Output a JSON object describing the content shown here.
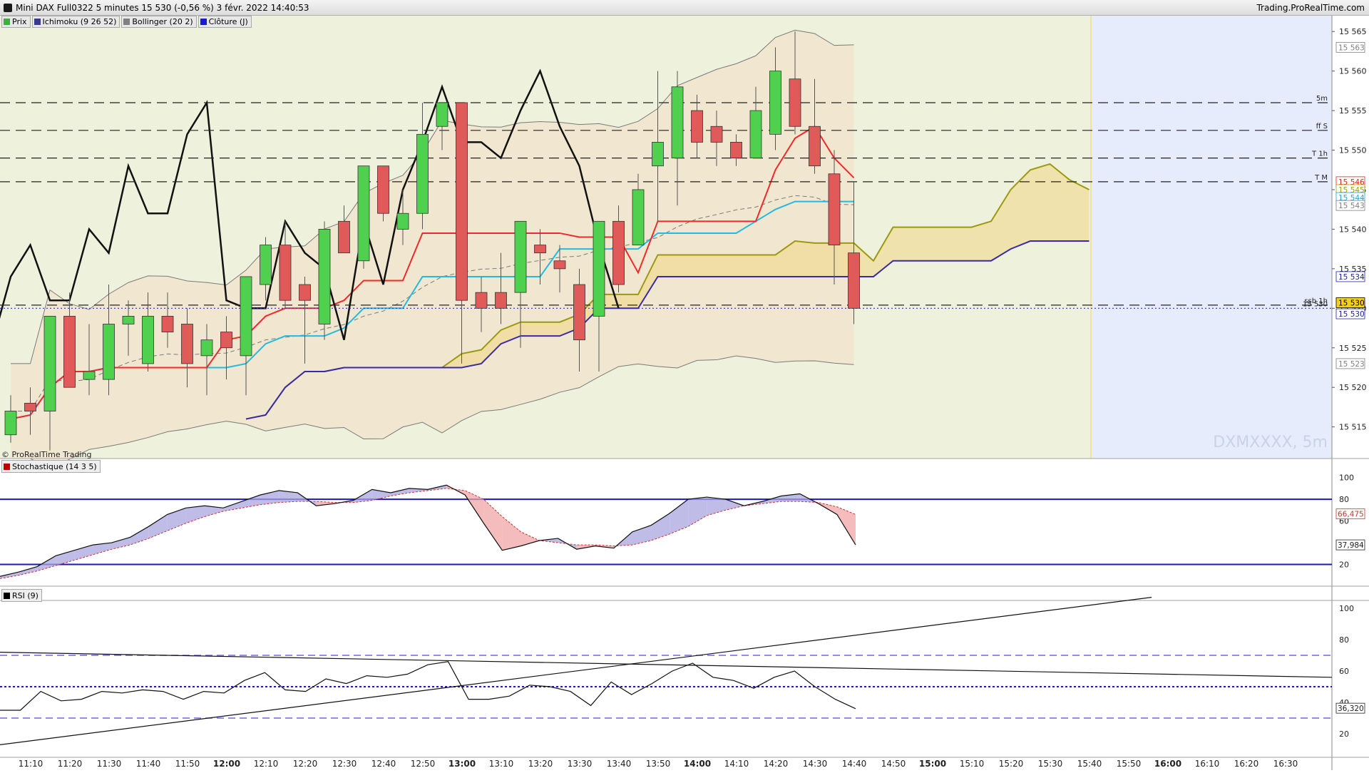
{
  "title": "Mini DAX Full0322 5 minutes 15 530 (-0,56 %) 3 févr. 2022 14:40:53",
  "site": "Trading.ProRealTime.com",
  "legend": [
    {
      "label": "Prix",
      "color": "#3fae3f"
    },
    {
      "label": "Ichimoku (9 26 52)",
      "color": "#3a3a8a"
    },
    {
      "label": "Bollinger (20 2)",
      "color": "#808080"
    },
    {
      "label": "Clôture (J)",
      "color": "#1a1ad0"
    }
  ],
  "copyright": "© ProRealTime Trading",
  "watermark": "DXMXXXX, 5m",
  "stoch_label": "Stochastique (14 3 5)",
  "rsi_label": "RSI (9)",
  "colors": {
    "up": "#4fd14f",
    "down": "#e05a5a",
    "cloud_bull": "#a8e3dc",
    "cloud_bear": "#f2d98c",
    "bg_session": "#eef1dc",
    "bg_future": "#e6ecfb"
  },
  "chart_data": [
    {
      "type": "candlestick",
      "name": "price",
      "ylim": [
        15511,
        15567
      ],
      "y_ticks": [
        15515,
        15520,
        15525,
        15530,
        15535,
        15540,
        15545,
        15550,
        15555,
        15560,
        15565
      ],
      "x_ticks": [
        "11:10",
        "11:20",
        "11:30",
        "11:40",
        "11:50",
        "12:00",
        "12:10",
        "12:20",
        "12:30",
        "12:40",
        "12:50",
        "13:00",
        "13:10",
        "13:20",
        "13:30",
        "13:40",
        "13:50",
        "14:00",
        "14:10",
        "14:20",
        "14:30",
        "14:40",
        "14:50",
        "15:00",
        "15:10",
        "15:20",
        "15:30",
        "15:40",
        "15:50",
        "16:00",
        "16:10",
        "16:20",
        "16:30"
      ],
      "candles": [
        {
          "t": "11:05",
          "o": 15514,
          "h": 15519,
          "l": 15513,
          "c": 15517
        },
        {
          "t": "11:10",
          "o": 15518,
          "h": 15520,
          "l": 15514,
          "c": 15517
        },
        {
          "t": "11:15",
          "o": 15517,
          "h": 15528,
          "l": 15512,
          "c": 15529
        },
        {
          "t": "11:20",
          "o": 15529,
          "h": 15532,
          "l": 15521,
          "c": 15520
        },
        {
          "t": "11:25",
          "o": 15521,
          "h": 15528,
          "l": 15519,
          "c": 15522
        },
        {
          "t": "11:30",
          "o": 15521,
          "h": 15533,
          "l": 15519,
          "c": 15528
        },
        {
          "t": "11:35",
          "o": 15528,
          "h": 15531,
          "l": 15524,
          "c": 15529
        },
        {
          "t": "11:40",
          "o": 15523,
          "h": 15532,
          "l": 15522,
          "c": 15529
        },
        {
          "t": "11:45",
          "o": 15529,
          "h": 15532,
          "l": 15525,
          "c": 15527
        },
        {
          "t": "11:50",
          "o": 15528,
          "h": 15530,
          "l": 15520,
          "c": 15523
        },
        {
          "t": "11:55",
          "o": 15524,
          "h": 15528,
          "l": 15519,
          "c": 15526
        },
        {
          "t": "12:00",
          "o": 15527,
          "h": 15529,
          "l": 15521,
          "c": 15525
        },
        {
          "t": "12:05",
          "o": 15524,
          "h": 15534,
          "l": 15519,
          "c": 15534
        },
        {
          "t": "12:10",
          "o": 15533,
          "h": 15539,
          "l": 15531,
          "c": 15538
        },
        {
          "t": "12:15",
          "o": 15538,
          "h": 15541,
          "l": 15530,
          "c": 15531
        },
        {
          "t": "12:20",
          "o": 15533,
          "h": 15534,
          "l": 15523,
          "c": 15531
        },
        {
          "t": "12:25",
          "o": 15528,
          "h": 15541,
          "l": 15526,
          "c": 15540
        },
        {
          "t": "12:30",
          "o": 15541,
          "h": 15543,
          "l": 15537,
          "c": 15537
        },
        {
          "t": "12:35",
          "o": 15536,
          "h": 15548,
          "l": 15535,
          "c": 15548
        },
        {
          "t": "12:40",
          "o": 15548,
          "h": 15548,
          "l": 15541,
          "c": 15542
        },
        {
          "t": "12:45",
          "o": 15540,
          "h": 15545,
          "l": 15538,
          "c": 15542
        },
        {
          "t": "12:50",
          "o": 15542,
          "h": 15556,
          "l": 15540,
          "c": 15552
        },
        {
          "t": "12:55",
          "o": 15553,
          "h": 15556,
          "l": 15550,
          "c": 15556
        },
        {
          "t": "13:00",
          "o": 15556,
          "h": 15556,
          "l": 15523,
          "c": 15531
        },
        {
          "t": "13:05",
          "o": 15532,
          "h": 15534,
          "l": 15527,
          "c": 15530
        },
        {
          "t": "13:10",
          "o": 15532,
          "h": 15537,
          "l": 15528,
          "c": 15530
        },
        {
          "t": "13:15",
          "o": 15532,
          "h": 15541,
          "l": 15525,
          "c": 15541
        },
        {
          "t": "13:20",
          "o": 15538,
          "h": 15540,
          "l": 15533,
          "c": 15537
        },
        {
          "t": "13:25",
          "o": 15536,
          "h": 15538,
          "l": 15532,
          "c": 15535
        },
        {
          "t": "13:30",
          "o": 15533,
          "h": 15535,
          "l": 15522,
          "c": 15526
        },
        {
          "t": "13:35",
          "o": 15529,
          "h": 15541,
          "l": 15522,
          "c": 15541
        },
        {
          "t": "13:40",
          "o": 15541,
          "h": 15543,
          "l": 15532,
          "c": 15533
        },
        {
          "t": "13:45",
          "o": 15538,
          "h": 15547,
          "l": 15538,
          "c": 15545
        },
        {
          "t": "13:50",
          "o": 15548,
          "h": 15560,
          "l": 15541,
          "c": 15551
        },
        {
          "t": "13:55",
          "o": 15549,
          "h": 15560,
          "l": 15543,
          "c": 15558
        },
        {
          "t": "14:00",
          "o": 15555,
          "h": 15557,
          "l": 15549,
          "c": 15551
        },
        {
          "t": "14:05",
          "o": 15553,
          "h": 15555,
          "l": 15548,
          "c": 15551
        },
        {
          "t": "14:10",
          "o": 15551,
          "h": 15552,
          "l": 15548,
          "c": 15549
        },
        {
          "t": "14:15",
          "o": 15549,
          "h": 15558,
          "l": 15549,
          "c": 15555
        },
        {
          "t": "14:20",
          "o": 15552,
          "h": 15563,
          "l": 15550,
          "c": 15560
        },
        {
          "t": "14:25",
          "o": 15559,
          "h": 15565,
          "l": 15552,
          "c": 15553
        },
        {
          "t": "14:30",
          "o": 15553,
          "h": 15559,
          "l": 15547,
          "c": 15548
        },
        {
          "t": "14:35",
          "o": 15547,
          "h": 15550,
          "l": 15533,
          "c": 15538
        },
        {
          "t": "14:40",
          "o": 15537,
          "h": 15546,
          "l": 15528,
          "c": 15530
        }
      ],
      "reference_lines": [
        {
          "label": "5m",
          "value": 15556,
          "style": "dashed"
        },
        {
          "label": "ff S",
          "value": 15552.5,
          "style": "dashed"
        },
        {
          "label": "T 1h",
          "value": 15549,
          "style": "dashed"
        },
        {
          "label": "T M",
          "value": 15546,
          "style": "dashed"
        },
        {
          "label": "ssb 1h",
          "value": 15530.4,
          "style": "dashed"
        },
        {
          "label": "15 530",
          "value": 15530,
          "style": "dotted"
        }
      ],
      "price_tags": [
        {
          "value": "15 563",
          "color": "#808080",
          "bg": "#ffffff"
        },
        {
          "value": "15 546",
          "color": "#e02020",
          "bg": "#ffffff"
        },
        {
          "value": "15 545",
          "color": "#a0a000",
          "bg": "#ffffff"
        },
        {
          "value": "15 544",
          "color": "#20a8d8",
          "bg": "#ffffff"
        },
        {
          "value": "15 543",
          "color": "#808080",
          "bg": "#ffffff"
        },
        {
          "value": "15 534",
          "color": "#2020b0",
          "bg": "#ffffff"
        },
        {
          "value": "15 530",
          "color": "#000000",
          "bg": "#f5d020"
        },
        {
          "value": "15 530",
          "color": "#2020b0",
          "bg": "#ffffff"
        },
        {
          "value": "15 523",
          "color": "#808080",
          "bg": "#ffffff"
        }
      ]
    },
    {
      "type": "line",
      "name": "Stochastique (14 3 5)",
      "ylim": [
        0,
        105
      ],
      "y_ticks": [
        20,
        40,
        60,
        80,
        100
      ],
      "levels": [
        20,
        80
      ],
      "k_label": "37,984",
      "d_label": "66,475",
      "k": [
        9,
        13,
        18,
        28,
        33,
        38,
        40,
        45,
        55,
        66,
        72,
        74,
        72,
        78,
        84,
        88,
        86,
        74,
        76,
        79,
        89,
        86,
        90,
        89,
        93,
        84,
        58,
        33,
        37,
        42,
        44,
        34,
        37,
        35,
        50,
        56,
        67,
        80,
        82,
        80,
        74,
        78,
        83,
        85,
        76,
        66,
        38
      ],
      "d": [
        7,
        10,
        14,
        19,
        24,
        29,
        34,
        38,
        44,
        51,
        58,
        64,
        69,
        72,
        75,
        77,
        78,
        78,
        77,
        77,
        79,
        83,
        86,
        88,
        90,
        88,
        80,
        64,
        50,
        42,
        40,
        38,
        38,
        37,
        38,
        42,
        48,
        55,
        65,
        70,
        74,
        76,
        78,
        78,
        77,
        73,
        66
      ]
    },
    {
      "type": "line",
      "name": "RSI (9)",
      "ylim": [
        5,
        105
      ],
      "y_ticks": [
        20,
        40,
        60,
        80,
        100
      ],
      "levels": [
        30,
        50,
        70
      ],
      "value_label": "36,320",
      "rsi": [
        35,
        35,
        47,
        41,
        42,
        47,
        46,
        48,
        47,
        42,
        47,
        46,
        54,
        59,
        48,
        47,
        55,
        52,
        57,
        56,
        58,
        64,
        66,
        42,
        42,
        44,
        51,
        50,
        47,
        38,
        53,
        45,
        52,
        60,
        65,
        56,
        54,
        49,
        56,
        60,
        50,
        42,
        36
      ]
    }
  ]
}
